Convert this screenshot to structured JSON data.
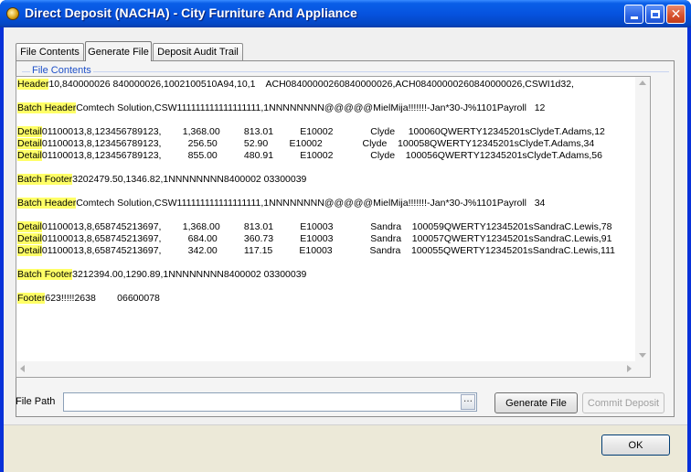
{
  "window": {
    "title": "Direct Deposit (NACHA) - City Furniture And Appliance",
    "close_glyph": "✕"
  },
  "tabs": [
    {
      "label": "File Contents"
    },
    {
      "label": "Generate File"
    },
    {
      "label": "Deposit Audit Trail"
    }
  ],
  "group": {
    "label": "File Contents"
  },
  "file_lines": [
    {
      "kw": "Header",
      "text": "10,840000026 840000026,1002100510A94,10,1    ACH0840000026084000002​6,ACH084000002608400000​26,CSWI1d32,"
    },
    {
      "kw": "",
      "text": ""
    },
    {
      "kw": "Batch Header",
      "text": "Comtech Solution,CSW111111111111111111,1NNNNNNNN@@@@@MielMija!!!!!!!-Jan*30-J%1101Payroll   12"
    },
    {
      "kw": "",
      "text": ""
    },
    {
      "kw": "Detail",
      "text": "01100013,8,123456789123,        1,368.00         813.01          E10002              Clyde     100060QWERTY12345201sClydeT.Adams,12"
    },
    {
      "kw": "Detail",
      "text": "01100013,8,123456789123,          256.50          52.90        E10002               Clyde    100058QWERTY12345201sClydeT.Adams,34"
    },
    {
      "kw": "Detail",
      "text": "01100013,8,123456789123,          855.00          480.91          E10002              Clyde    100056QWERTY12345201sClydeT.Adams,56"
    },
    {
      "kw": "",
      "text": ""
    },
    {
      "kw": "Batch Footer",
      "text": "3202479.50,1346.82,1NNNNNNNN8400002 03300039"
    },
    {
      "kw": "",
      "text": ""
    },
    {
      "kw": "Batch Header",
      "text": "Comtech Solution,CSW111111111111111111,1NNNNNNNN@@@@@MielMija!!!!!!!-Jan*30-J%1101Payroll   34"
    },
    {
      "kw": "",
      "text": ""
    },
    {
      "kw": "Detail",
      "text": "01100013,8,658745213697,        1,368.00         813.01          E10003              Sandra    100059QWERTY12345201sSandraC.Lewis,78"
    },
    {
      "kw": "Detail",
      "text": "01100013,8,658745213697,          684.00          360.73          E10003              Sandra    100057QWERTY12345201sSandraC.Lewis,91"
    },
    {
      "kw": "Detail",
      "text": "01100013,8,658745213697,          342.00          117.15          E10003              Sandra    100055QWERTY12345201sSandraC.Lewis,111"
    },
    {
      "kw": "",
      "text": ""
    },
    {
      "kw": "Batch Footer",
      "text": "3212394.00,1290.89,1NNNNNNNN8400002 03300039"
    },
    {
      "kw": "",
      "text": ""
    },
    {
      "kw": "Footer",
      "text": "623!!!!!2638        06600078"
    }
  ],
  "file_path": {
    "label": "File Path",
    "value": "",
    "browse_label": "…"
  },
  "buttons": {
    "generate": "Generate File",
    "commit": "Commit Deposit",
    "ok": "OK"
  },
  "colors": {
    "highlight": "#ffff66",
    "title_bar": "#0653df",
    "group_label": "#1e50c8"
  }
}
